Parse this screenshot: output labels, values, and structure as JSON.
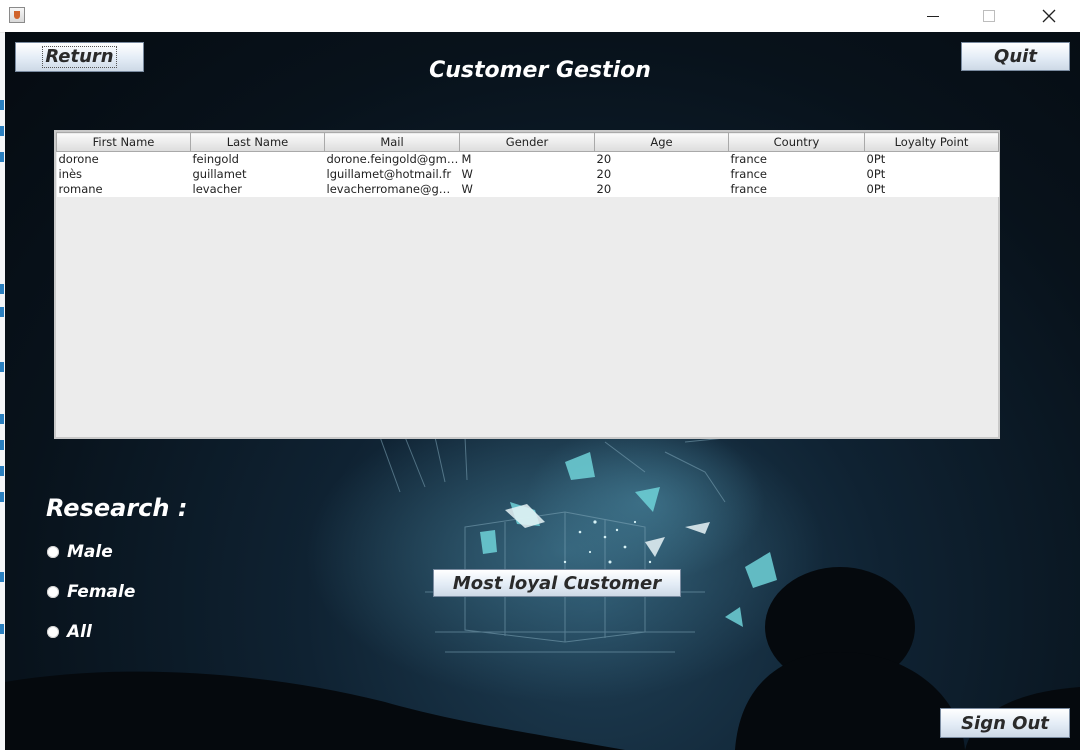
{
  "titlebar": {
    "icon": "java-cup-icon"
  },
  "header": {
    "title": "Customer Gestion",
    "return_label": "Return",
    "quit_label": "Quit"
  },
  "table": {
    "columns": [
      "First Name",
      "Last Name",
      "Mail",
      "Gender",
      "Age",
      "Country",
      "Loyalty Point"
    ],
    "rows": [
      [
        "dorone",
        "feingold",
        "dorone.feingold@gma...",
        "M",
        "20",
        "france",
        "0Pt"
      ],
      [
        "inès",
        "guillamet",
        "lguillamet@hotmail.fr",
        "W",
        "20",
        "france",
        "0Pt"
      ],
      [
        "romane",
        "levacher",
        "levacherromane@gm...",
        "W",
        "20",
        "france",
        "0Pt"
      ]
    ]
  },
  "research": {
    "title": "Research :",
    "options": [
      "Male",
      "Female",
      "All"
    ]
  },
  "buttons": {
    "most_loyal": "Most loyal Customer",
    "sign_out": "Sign Out"
  },
  "colors": {
    "background": "#0a1620",
    "accent_teal": "#5fd7dc",
    "text_white": "#ffffff"
  }
}
